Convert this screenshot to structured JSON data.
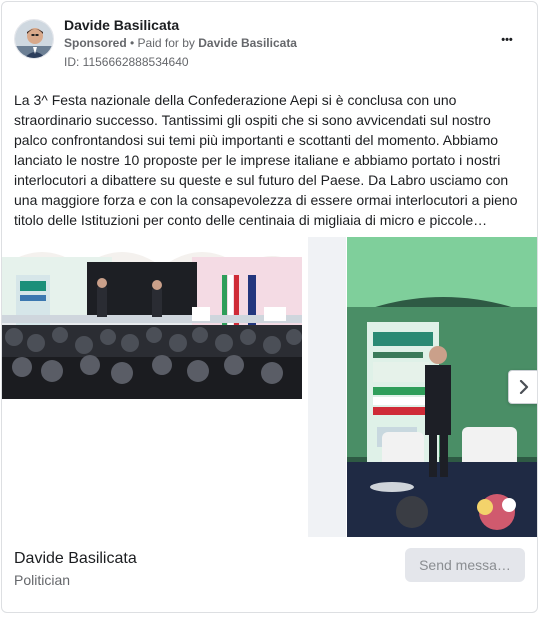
{
  "post": {
    "author": "Davide Basilicata",
    "sponsored_label": "Sponsored",
    "paid_for_prefix": "• Paid for by",
    "paid_for_name": "Davide Basilicata",
    "id_line": "ID: 1156662888534640",
    "more_icon": "ellipsis-icon",
    "more_label": "•••",
    "body": "La 3^ Festa nazionale della Confederazione Aepi si è conclusa con uno straordinario successo. Tantissimi gli ospiti che si sono avvicendati sul nostro palco confrontandosi sui temi più importanti e scottanti del momento. Abbiamo lanciato le nostre 10 proposte per le imprese italiane e abbiamo portato i nostri interlocutori a dibattere su queste e sul futuro del Paese. Da Labro usciamo con una maggiore forza e con la consapevolezza di essere ormai interlocutori a pieno titolo delle Istituzioni per conto delle centinaia di migliaia di micro e piccole…"
  },
  "carousel": {
    "next_icon": "chevron-right-icon"
  },
  "footer": {
    "page_name": "Davide Basilicata",
    "page_category": "Politician",
    "send_button": "Send messa…"
  },
  "colors": {
    "primary_text": "#1c1e21",
    "secondary_text": "#65676b",
    "disabled_button_bg": "#e4e6eb"
  }
}
